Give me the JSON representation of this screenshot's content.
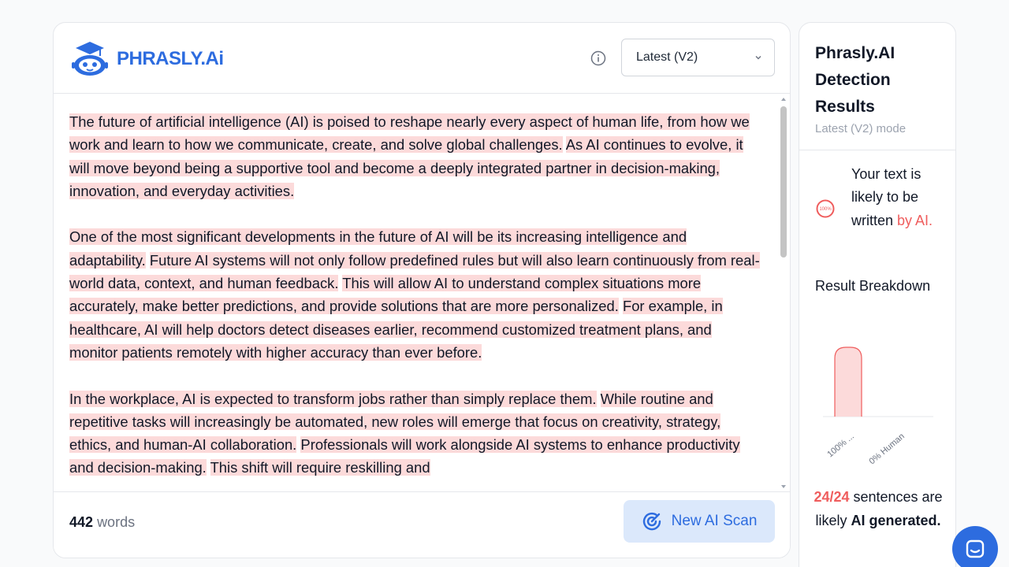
{
  "brand": {
    "name": "PHRASLY.Ai"
  },
  "mode_select": {
    "value": "Latest (V2)"
  },
  "document": {
    "paragraphs": [
      [
        "The future of artificial intelligence (AI) is poised to reshape nearly every aspect of human life, from how we work and learn to how we communicate, create, and solve global challenges.",
        "As AI continues to evolve, it will move beyond being a supportive tool and become a deeply integrated partner in decision-making, innovation, and everyday activities."
      ],
      [
        "One of the most significant developments in the future of AI will be its increasing intelligence and adaptability.",
        "Future AI systems will not only follow predefined rules but will also learn continuously from real-world data, context, and human feedback.",
        "This will allow AI to understand complex situations more accurately, make better predictions, and provide solutions that are more personalized.",
        "For example, in healthcare, AI will help doctors detect diseases earlier, recommend customized treatment plans, and monitor patients remotely with higher accuracy than ever before."
      ],
      [
        "In the workplace, AI is expected to transform jobs rather than simply replace them.",
        "While routine and repetitive tasks will increasingly be automated, new roles will emerge that focus on creativity, strategy, ethics, and human-AI collaboration.",
        "Professionals will work alongside AI systems to enhance productivity and decision-making.",
        "This shift will require reskilling and"
      ]
    ]
  },
  "footer": {
    "word_count": "442",
    "word_label": "words",
    "scan_button": "New AI Scan"
  },
  "results": {
    "title": "Phrasly.AI Detection Results",
    "subtitle": "Latest (V2) mode",
    "verdict_prefix": "Your text is likely to be written ",
    "verdict_ai": "by AI.",
    "gauge_label": "100%",
    "breakdown_title": "Result Breakdown",
    "summary_count": "24/24",
    "summary_mid": " sentences are likely ",
    "summary_ai": "AI",
    "summary_end": " generated."
  },
  "chart_data": {
    "type": "bar",
    "categories": [
      "100% ...",
      "0% Human"
    ],
    "values": [
      100,
      0
    ],
    "ylim": [
      0,
      100
    ],
    "colors": [
      "#fcdada",
      "#e5e7eb"
    ],
    "bar_stroke": "#ef5d5d"
  },
  "colors": {
    "brand_blue": "#2d6cdf",
    "ai_red": "#ef5d5d",
    "highlight": "#fcdada"
  }
}
